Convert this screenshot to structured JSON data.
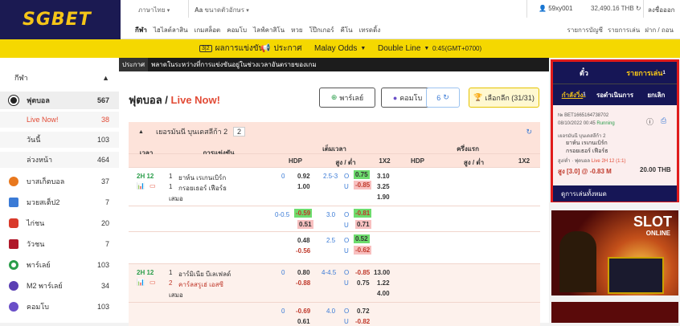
{
  "brand": {
    "logo": "SGBET"
  },
  "topbar": {
    "language": "ภาษาไทย",
    "font_size": "ขนาดตัวอักษร",
    "username": "59xy001",
    "balance": "32,490.16 THB",
    "logout": "ลงชื่อออก"
  },
  "mainnav": [
    "กีฬา",
    "ไฮไลต์ลาสิน",
    "เกมสล็อต",
    "คอมโบ",
    "ไลฟ์คาสิโน",
    "หวย",
    "โป๊กเกอร์",
    "คีโน",
    "เทรดดิ้ง"
  ],
  "rightnav": [
    "รายการบัญชี",
    "รายการเล่น",
    "ฝาก / ถอน"
  ],
  "yellowbar": {
    "badge": "3|2",
    "results": "ผลการแข่งขัน",
    "announce": "ประกาศ",
    "odds_type": "Malay Odds",
    "line_type": "Double Line",
    "time": "0:45(GMT+0700)"
  },
  "sidebar": {
    "header": "กีฬา",
    "items": [
      {
        "label": "ฟุตบอล",
        "count": "567",
        "icon": "soccer-ball-icon"
      },
      {
        "label": "Live Now!",
        "count": "38",
        "icon": ""
      },
      {
        "label": "วันนี้",
        "count": "103",
        "icon": ""
      },
      {
        "label": "ล่วงหน้า",
        "count": "464",
        "icon": ""
      },
      {
        "label": "บาสเก็ตบอล",
        "count": "37",
        "icon": "basketball-icon"
      },
      {
        "label": "มวยสเต็ป2",
        "count": "7",
        "icon": "parlay-icon"
      },
      {
        "label": "ไก่ชน",
        "count": "20",
        "icon": "rooster-icon"
      },
      {
        "label": "วัวชน",
        "count": "7",
        "icon": "bull-icon"
      },
      {
        "label": "พาร์เลย์",
        "count": "103",
        "icon": "parlay-ball-icon"
      },
      {
        "label": "M2 พาร์เลย์",
        "count": "34",
        "icon": "m2-parlay-icon"
      },
      {
        "label": "คอมโบ",
        "count": "103",
        "icon": "combo-icon"
      }
    ]
  },
  "ticker": {
    "label": "ประกาศ",
    "text": "พลาดในระหว่างที่การแข่งขันอยู่ในช่วงเวลาอันตรายของเกม"
  },
  "page": {
    "title": "ฟุตบอล /",
    "subtitle": "Live Now!"
  },
  "toolbar": {
    "parlay": "พาร์เลย์",
    "combo": "คอมโบ",
    "refresh_count": "6",
    "select_league": "เลือกลีก (31/31)"
  },
  "league": {
    "name": "เยอรมันนี บุนเดสลีก้า 2",
    "count": "2"
  },
  "table": {
    "headers": {
      "time": "เวลา",
      "match": "การแข่งขัน",
      "full": "เต็มเวลา",
      "half": "ครึ่งแรก",
      "hdp": "HDP",
      "ou": "สูง / ต่ำ",
      "x12": "1X2"
    },
    "matches": [
      {
        "time": "2H 12",
        "home": "ยาห์น เรเกนเบิร์ก",
        "away": "กรอยเธอร์ เฟือร์ธ",
        "draw": "เสมอ",
        "home_score": "1",
        "away_score": "1",
        "lines": [
          {
            "hdp_h": "0",
            "hdp_v1": "0.92",
            "hdp_v2": "1.00",
            "ou_line": "2.5-3",
            "ou_o": "0.75",
            "ou_u": "-0.85",
            "x1": "3.10",
            "xx": "3.25",
            "x2": "1.90"
          },
          {
            "hdp_h": "0-0.5",
            "hdp_v1": "-0.59",
            "hdp_v2": "0.51",
            "ou_line": "3.0",
            "ou_o": "-0.81",
            "ou_u": "0.71"
          },
          {
            "hdp_h": "",
            "hdp_v1": "0.48",
            "hdp_v2": "-0.56",
            "ou_line": "2.5",
            "ou_o": "0.52",
            "ou_u": "-0.62"
          }
        ]
      },
      {
        "time": "2H 12",
        "home": "อาร์มิเนีย บีเลเฟลด์",
        "away": "คาร์ลสรูเฮ่ เอสซี",
        "draw": "เสมอ",
        "home_score": "1",
        "away_score": "2",
        "lines": [
          {
            "hdp_h": "0",
            "hdp_v1": "0.80",
            "hdp_v2": "-0.88",
            "ou_line": "4-4.5",
            "ou_o": "-0.85",
            "ou_u": "0.75",
            "x1": "13.00",
            "xx": "1.22",
            "x2": "4.00"
          },
          {
            "hdp_h": "0",
            "hdp_v1": "-0.69",
            "hdp_v2": "0.61",
            "ou_line": "4.0",
            "ou_o": "0.72",
            "ou_u": "-0.82"
          }
        ]
      }
    ]
  },
  "betslip": {
    "tab1": "ตั๋ว",
    "tab2": "รายการเล่น",
    "tab2_badge": "1",
    "sub1": "กำลังวิ่ง",
    "sub1_badge": "1",
    "sub2": "รอดำเนินการ",
    "sub3": "ยกเลิก",
    "bet_no": "№ BET1665164738702",
    "bet_date": "08/10/2022 00:45",
    "bet_status": "Running",
    "league": "เยอรมันนี บุนเดสลีก้า 2",
    "home": "ยาห์น เรเกนเบิร์ก",
    "away": "กรอยเธอร์ เฟือร์ธ",
    "bet_type": "สูง/ต่ำ · ฟุตบอล",
    "bet_live": "Live 2H 12 (1:1)",
    "bet_pick": "สูง [3.0] @ -0.83 M",
    "bet_amount": "20.00 THB",
    "footer": "ดูการเล่นทั้งหมด"
  },
  "banner": {
    "title": "SLOT",
    "subtitle": "ONLINE"
  }
}
